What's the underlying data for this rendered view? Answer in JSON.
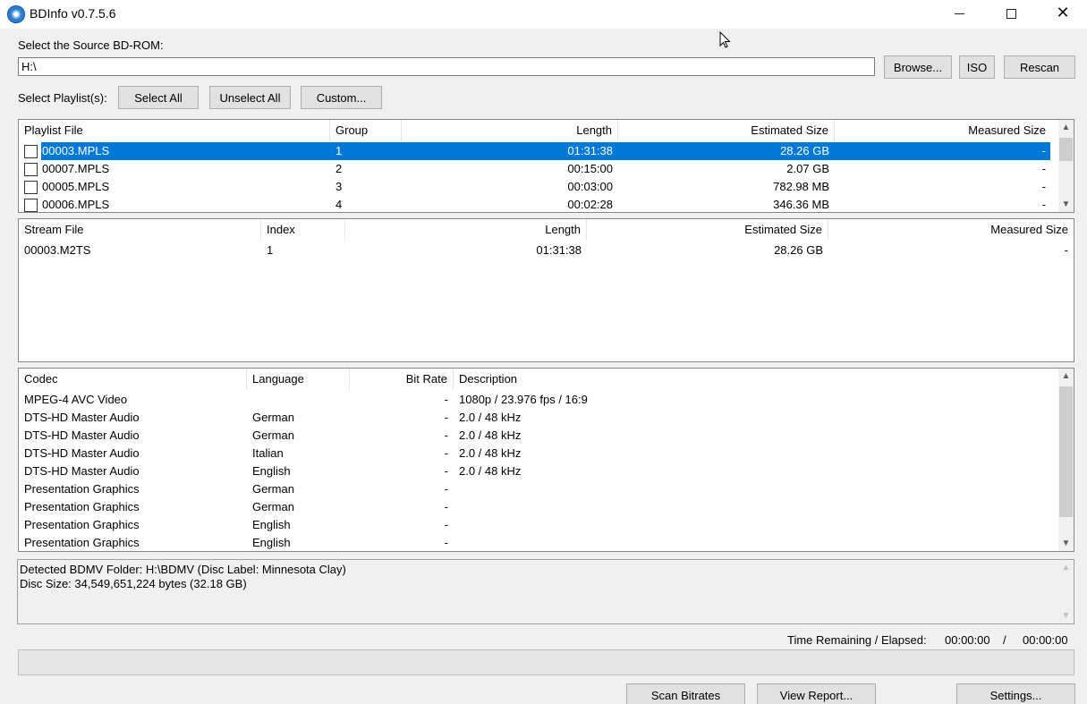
{
  "window": {
    "title": "BDInfo v0.7.5.6"
  },
  "source": {
    "label": "Select the Source BD-ROM:",
    "path": "H:\\",
    "browse_label": "Browse...",
    "iso_label": "ISO",
    "rescan_label": "Rescan"
  },
  "playlist_select": {
    "label": "Select Playlist(s):",
    "select_all_label": "Select All",
    "unselect_all_label": "Unselect All",
    "custom_label": "Custom..."
  },
  "playlists": {
    "columns": [
      "Playlist File",
      "Group",
      "Length",
      "Estimated Size",
      "Measured Size"
    ],
    "rows": [
      {
        "file": "00003.MPLS",
        "group": "1",
        "length": "01:31:38",
        "est_size": "28.26 GB",
        "measured": "-",
        "checked": false,
        "selected": true
      },
      {
        "file": "00007.MPLS",
        "group": "2",
        "length": "00:15:00",
        "est_size": "2.07 GB",
        "measured": "-",
        "checked": false,
        "selected": false
      },
      {
        "file": "00005.MPLS",
        "group": "3",
        "length": "00:03:00",
        "est_size": "782.98 MB",
        "measured": "-",
        "checked": false,
        "selected": false
      },
      {
        "file": "00006.MPLS",
        "group": "4",
        "length": "00:02:28",
        "est_size": "346.36 MB",
        "measured": "-",
        "checked": false,
        "selected": false
      }
    ]
  },
  "streams": {
    "columns": [
      "Stream File",
      "Index",
      "Length",
      "Estimated Size",
      "Measured Size"
    ],
    "rows": [
      {
        "file": "00003.M2TS",
        "index": "1",
        "length": "01:31:38",
        "est_size": "28.26 GB",
        "measured": "-"
      }
    ]
  },
  "codecs": {
    "columns": [
      "Codec",
      "Language",
      "Bit Rate",
      "Description"
    ],
    "rows": [
      {
        "codec": "MPEG-4 AVC Video",
        "language": "",
        "bitrate": "-",
        "description": "1080p / 23.976 fps / 16:9"
      },
      {
        "codec": "DTS-HD Master Audio",
        "language": "German",
        "bitrate": "-",
        "description": "2.0 / 48 kHz"
      },
      {
        "codec": "DTS-HD Master Audio",
        "language": "German",
        "bitrate": "-",
        "description": "2.0 / 48 kHz"
      },
      {
        "codec": "DTS-HD Master Audio",
        "language": "Italian",
        "bitrate": "-",
        "description": "2.0 / 48 kHz"
      },
      {
        "codec": "DTS-HD Master Audio",
        "language": "English",
        "bitrate": "-",
        "description": "2.0 / 48 kHz"
      },
      {
        "codec": "Presentation Graphics",
        "language": "German",
        "bitrate": "-",
        "description": ""
      },
      {
        "codec": "Presentation Graphics",
        "language": "German",
        "bitrate": "-",
        "description": ""
      },
      {
        "codec": "Presentation Graphics",
        "language": "English",
        "bitrate": "-",
        "description": ""
      },
      {
        "codec": "Presentation Graphics",
        "language": "English",
        "bitrate": "-",
        "description": ""
      }
    ]
  },
  "info": {
    "line1": "Detected BDMV Folder: H:\\BDMV (Disc Label: Minnesota Clay)",
    "line2": "Disc Size: 34,549,651,224 bytes (32.18 GB)"
  },
  "time": {
    "label": "Time Remaining / Elapsed:",
    "remaining": "00:00:00",
    "separator": "/",
    "elapsed": "00:00:00"
  },
  "progress": {
    "value": 0
  },
  "actions": {
    "scan_label": "Scan Bitrates",
    "view_report_label": "View Report...",
    "settings_label": "Settings..."
  },
  "colors": {
    "selection": "#0078d7",
    "background": "#f0f0f0"
  }
}
